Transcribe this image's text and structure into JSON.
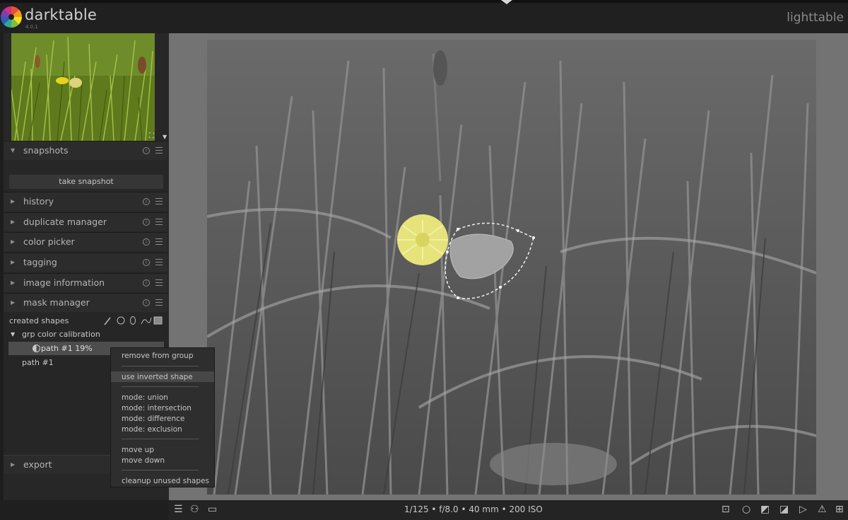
{
  "app": {
    "title": "darktable",
    "version": "4.0.1",
    "view": "lighttable"
  },
  "modules": [
    {
      "label": "snapshots",
      "expanded": true
    },
    {
      "label": "history",
      "expanded": false
    },
    {
      "label": "duplicate manager",
      "expanded": false
    },
    {
      "label": "color picker",
      "expanded": false
    },
    {
      "label": "tagging",
      "expanded": false
    },
    {
      "label": "image information",
      "expanded": false
    },
    {
      "label": "mask manager",
      "expanded": true
    },
    {
      "label": "export",
      "expanded": false
    }
  ],
  "snapshots": {
    "button": "take snapshot"
  },
  "mask_manager": {
    "created_label": "created shapes",
    "group_name": "grp color calibration",
    "selected_item": "path #1 19%",
    "item": "path #1"
  },
  "context_menu": {
    "items": [
      "remove from group",
      "use inverted shape",
      "mode: union",
      "mode: intersection",
      "mode: difference",
      "mode: exclusion",
      "move up",
      "move down",
      "cleanup unused shapes"
    ],
    "hovered": "use inverted shape"
  },
  "status": {
    "exif": "1/125 • f/8.0 • 40 mm • 200 ISO"
  },
  "colors": {
    "accent_yellow": "#e6e37a",
    "panel_bg": "#272727",
    "center_bg": "#737373"
  },
  "icons": {
    "bottom_left": [
      "hamburger-icon",
      "color-circles-icon",
      "display-icon"
    ],
    "bottom_right": [
      "focus-peaking-icon",
      "bulb-icon",
      "color-assessment-icon",
      "overexposed-icon",
      "softproof-icon",
      "warning-icon",
      "grid-icon"
    ]
  }
}
